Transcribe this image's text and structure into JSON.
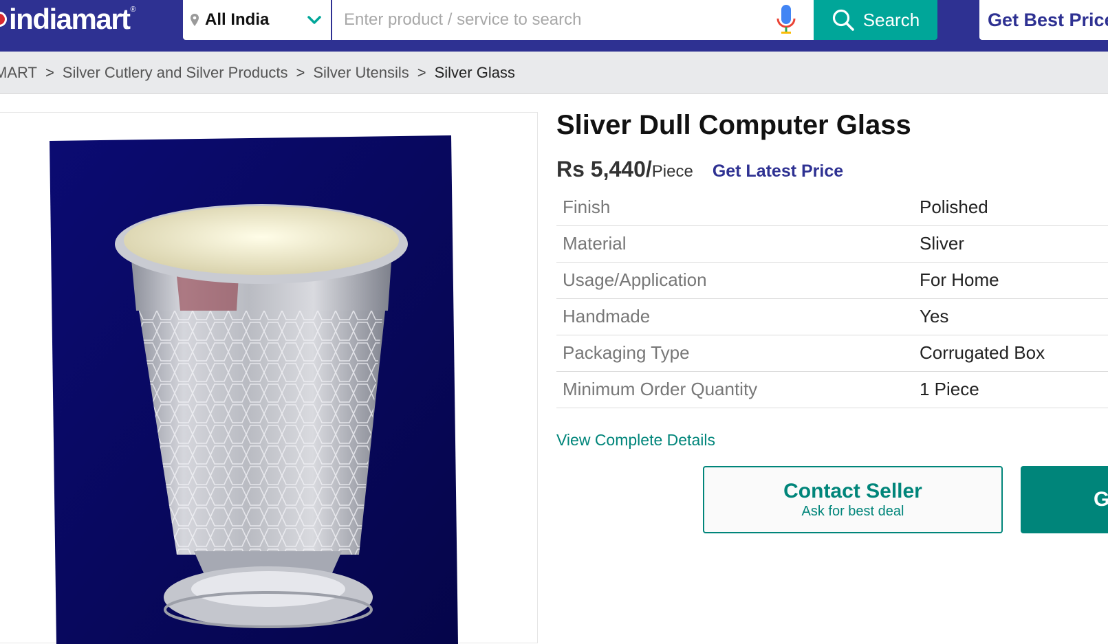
{
  "header": {
    "logo_text": "indiamart",
    "logo_reg": "®",
    "location": "All India",
    "search_placeholder": "Enter product / service to search",
    "search_button": "Search",
    "best_price_button": "Get Best Price"
  },
  "breadcrumb": [
    {
      "label": "MART"
    },
    {
      "label": "Silver Cutlery and Silver Products"
    },
    {
      "label": "Silver Utensils"
    },
    {
      "label": "Silver Glass"
    }
  ],
  "breadcrumb_separator": ">",
  "product": {
    "title": "Sliver Dull Computer Glass",
    "price": "Rs 5,440/",
    "price_unit": "Piece",
    "latest_price_link": "Get Latest Price",
    "specs": [
      {
        "label": "Finish",
        "value": "Polished"
      },
      {
        "label": "Material",
        "value": "Sliver"
      },
      {
        "label": "Usage/Application",
        "value": "For Home"
      },
      {
        "label": "Handmade",
        "value": "Yes"
      },
      {
        "label": "Packaging Type",
        "value": "Corrugated Box"
      },
      {
        "label": "Minimum Order Quantity",
        "value": "1 Piece"
      }
    ],
    "view_details": "View Complete Details",
    "contact_button": {
      "title": "Contact Seller",
      "subtitle": "Ask for best deal"
    },
    "get_button": "G"
  },
  "colors": {
    "header_bg": "#2e3192",
    "accent_teal": "#00a699",
    "cta_teal": "#00857a",
    "image_bg": "#0a0a6e"
  },
  "icons": [
    "location-pin-icon",
    "chevron-down-icon",
    "microphone-icon",
    "search-icon"
  ]
}
